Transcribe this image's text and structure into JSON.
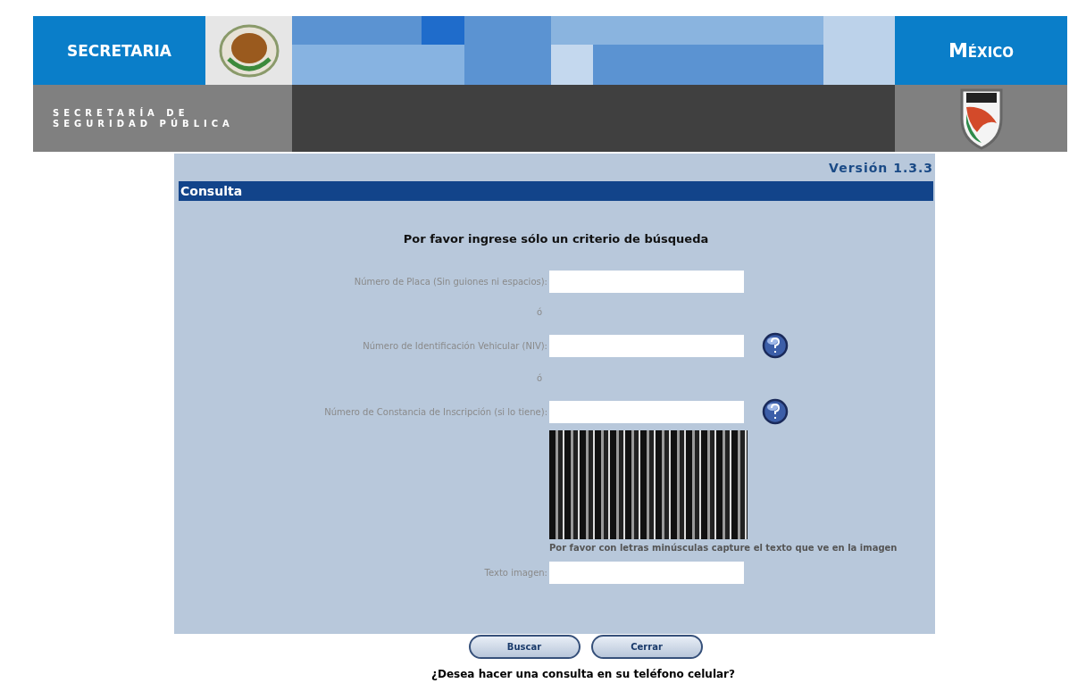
{
  "header": {
    "left_title": "SECRETARIA",
    "right_title": "México",
    "agency_name": "SECRETARÍA DE SEGURIDAD PÚBLICA"
  },
  "version": "Versión 1.3.3",
  "section_title": "Consulta",
  "instruction": "Por favor ingrese sólo un criterio de búsqueda",
  "fields": [
    {
      "kind": "input",
      "label": "Número de Placa (Sin guiones ni espacios):",
      "help": false
    },
    {
      "kind": "separator",
      "label": "ó"
    },
    {
      "kind": "input",
      "label": "Número de Identificación Vehicular (NIV):",
      "help": true
    },
    {
      "kind": "separator",
      "label": "ó"
    },
    {
      "kind": "input",
      "label": "Número de Constancia de Inscripción (si lo tiene):",
      "help": true
    }
  ],
  "captcha": {
    "hint": "Por favor con letras minúsculas capture el texto que ve en la imagen",
    "label": "Texto imagen:"
  },
  "buttons": [
    "Buscar",
    "Cerrar"
  ],
  "footer_question": "¿Desea hacer una consulta en su teléfono celular?"
}
